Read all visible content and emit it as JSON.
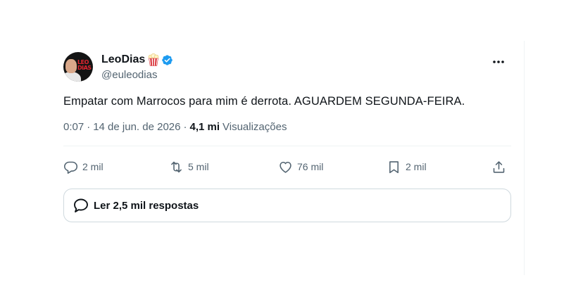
{
  "tweet": {
    "author": {
      "display_name": "LeoDias",
      "handle": "@euleodias",
      "avatar_icon": "avatar-leodias",
      "badge_icons": [
        "popcorn-icon",
        "verified-badge-icon"
      ],
      "verified_color": "#1d9bf0"
    },
    "text": "Empatar com Marrocos para mim é derrota. AGUARDEM SEGUNDA-FEIRA.",
    "meta": {
      "time": "0:07",
      "date": "14 de jun. de 2026",
      "views_count": "4,1 mi",
      "views_label": "Visualizações"
    },
    "actions": {
      "replies": "2 mil",
      "reposts": "5 mil",
      "likes": "76 mil",
      "bookmarks": "2 mil"
    },
    "read_replies_label": "Ler 2,5 mil respostas"
  },
  "colors": {
    "text_primary": "#0f1419",
    "text_secondary": "#536471",
    "divider": "#eff3f4",
    "border": "#cfd9de"
  }
}
